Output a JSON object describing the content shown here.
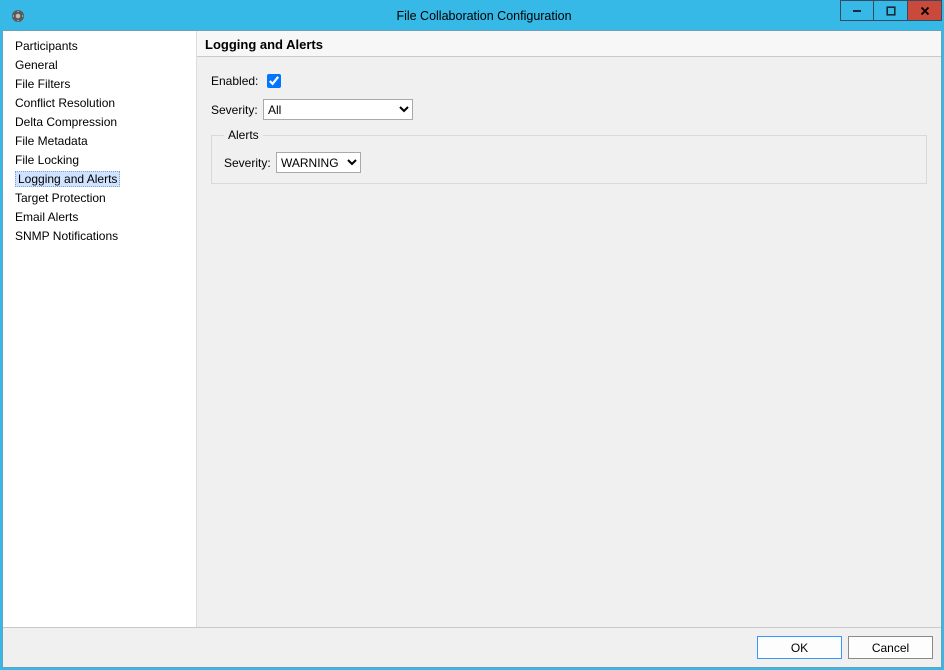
{
  "window": {
    "title": "File Collaboration Configuration"
  },
  "sidebar": {
    "items": [
      {
        "label": "Participants"
      },
      {
        "label": "General"
      },
      {
        "label": "File Filters"
      },
      {
        "label": "Conflict Resolution"
      },
      {
        "label": "Delta Compression"
      },
      {
        "label": "File Metadata"
      },
      {
        "label": "File Locking"
      },
      {
        "label": "Logging and Alerts",
        "selected": true
      },
      {
        "label": "Target Protection"
      },
      {
        "label": "Email Alerts"
      },
      {
        "label": "SNMP Notifications"
      }
    ]
  },
  "panel": {
    "heading": "Logging and Alerts",
    "enabled_label": "Enabled:",
    "enabled_checked": true,
    "severity_label": "Severity:",
    "severity_value": "All",
    "alerts_legend": "Alerts",
    "alerts_severity_label": "Severity:",
    "alerts_severity_value": "WARNING"
  },
  "footer": {
    "ok_label": "OK",
    "cancel_label": "Cancel"
  }
}
